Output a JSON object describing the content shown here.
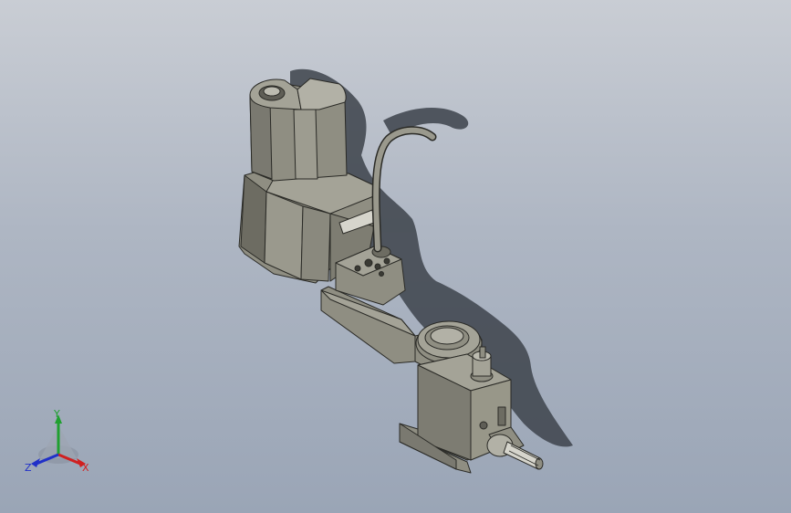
{
  "viewport": {
    "model": "robot-arm-assembly",
    "colors": {
      "background_top": "#c9cdd4",
      "background_bottom": "#9aa5b6",
      "body": "#8f8e82",
      "body_light": "#a4a397",
      "body_dark": "#6d6c62",
      "edge": "#2a2a26",
      "shadow": "#3d434b"
    }
  },
  "triad": {
    "x_label": "X",
    "y_label": "Y",
    "z_label": "Z",
    "colors": {
      "x": "#d02020",
      "y": "#20a030",
      "z": "#2030c8"
    }
  }
}
